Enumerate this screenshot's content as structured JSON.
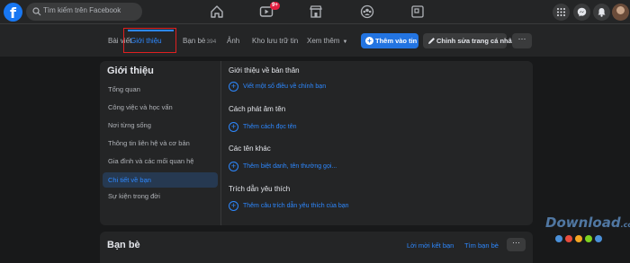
{
  "topbar": {
    "logo": "f",
    "search_placeholder": "Tìm kiếm trên Facebook",
    "nav_icons": [
      "home-icon",
      "watch-icon",
      "marketplace-icon",
      "groups-icon",
      "gaming-icon"
    ],
    "watch_badge": "9+",
    "right_icons": [
      "menu-grid-icon",
      "messenger-icon",
      "notifications-icon"
    ]
  },
  "profile_nav": {
    "tabs": [
      {
        "label": "Bài viết"
      },
      {
        "label": "Giới thiệu",
        "active": true
      },
      {
        "label": "Bạn bè",
        "count": "394"
      },
      {
        "label": "Ảnh"
      },
      {
        "label": "Kho lưu trữ tin"
      },
      {
        "label": "Xem thêm"
      }
    ],
    "add_story_label": "Thêm vào tin",
    "edit_profile_label": "Chỉnh sửa trang cá nhân",
    "more_label": "···"
  },
  "about": {
    "title": "Giới thiệu",
    "sidebar": [
      {
        "label": "Tổng quan"
      },
      {
        "label": "Công việc và học vấn"
      },
      {
        "label": "Nơi từng sống"
      },
      {
        "label": "Thông tin liên hệ và cơ bản"
      },
      {
        "label": "Gia đình và các mối quan hệ"
      },
      {
        "label": "Chi tiết về bạn",
        "active": true
      },
      {
        "label": "Sự kiện trong đời"
      }
    ],
    "sections": [
      {
        "title": "Giới thiệu về bản thân",
        "link": "Viết một số điều về chính bạn"
      },
      {
        "title": "Cách phát âm tên",
        "link": "Thêm cách đọc tên"
      },
      {
        "title": "Các tên khác",
        "link": "Thêm biệt danh, tên thường gọi..."
      },
      {
        "title": "Trích dẫn yêu thích",
        "link": "Thêm câu trích dẫn yêu thích của bạn"
      }
    ]
  },
  "friends": {
    "title": "Bạn bè",
    "requests_link": "Lời mời kết bạn",
    "find_link": "Tìm bạn bè",
    "more_label": "···"
  },
  "watermark": {
    "text": "Download",
    "domain": ".com.vn",
    "dot_colors": [
      "#4a90d9",
      "#e84c3d",
      "#f5a623",
      "#7ed321",
      "#4a90d9"
    ]
  },
  "colors": {
    "accent": "#2d88ff",
    "button_blue": "#2374e1",
    "highlight_box": "#e02020",
    "badge_red": "#e41e3f"
  }
}
